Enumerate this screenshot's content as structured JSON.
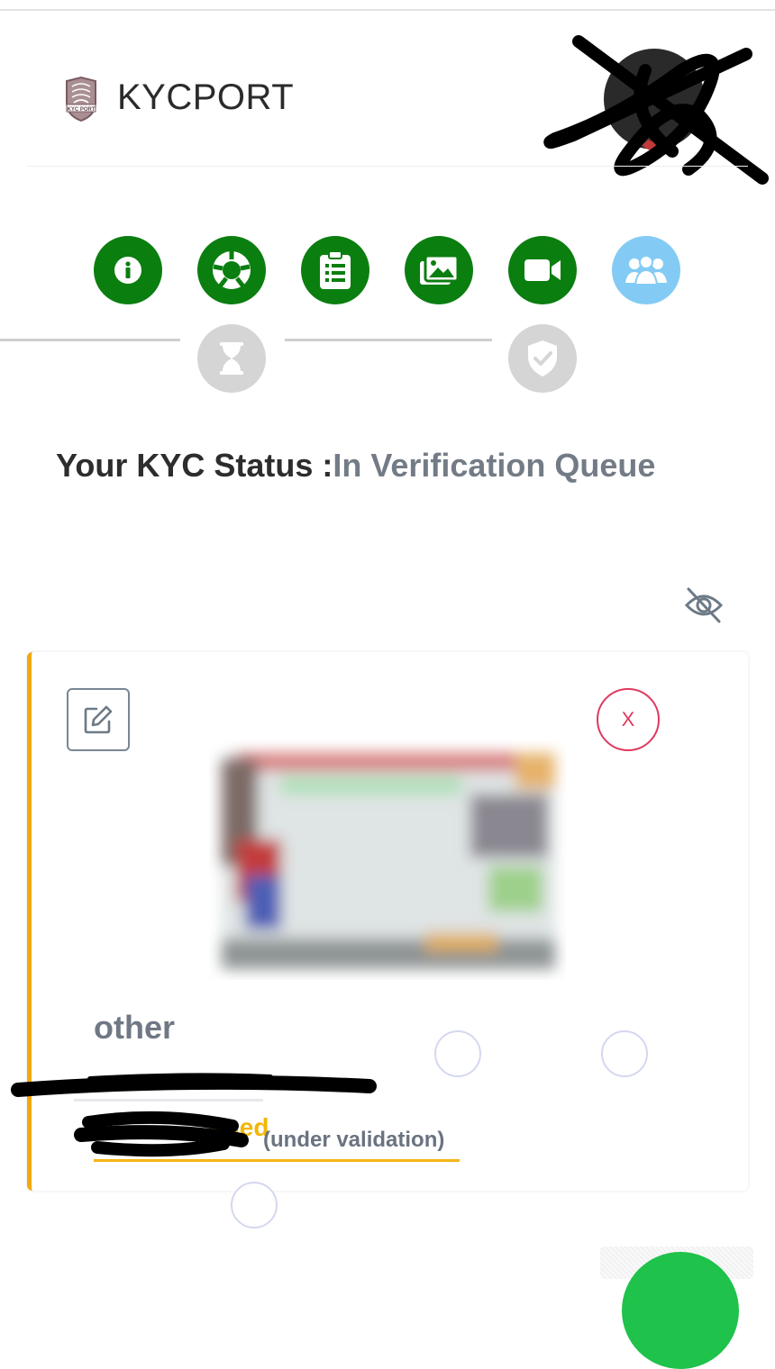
{
  "header": {
    "brand": "KYCPORT",
    "logo_text": "KYC PORT"
  },
  "steps": {
    "top": [
      {
        "name": "info-icon",
        "state": "done"
      },
      {
        "name": "lifebuoy-icon",
        "state": "done"
      },
      {
        "name": "clipboard-icon",
        "state": "done"
      },
      {
        "name": "images-icon",
        "state": "done"
      },
      {
        "name": "video-camera-icon",
        "state": "done"
      },
      {
        "name": "users-icon",
        "state": "active"
      }
    ],
    "bottom": [
      {
        "name": "hourglass-icon",
        "state": "pending"
      },
      {
        "name": "shield-check-icon",
        "state": "pending"
      }
    ],
    "colors": {
      "done": "#0b7e10",
      "active": "#83cbf5",
      "pending": "#d5d5d5"
    }
  },
  "status": {
    "label": "Your KYC Status :",
    "value": "In Verification Queue"
  },
  "document": {
    "type": "other",
    "confirmed_label": "rmed",
    "validation_note": "(under validation)",
    "close_label": "X"
  },
  "colors": {
    "accent": "#f2a90f",
    "danger": "#e0395d",
    "success": "#1fc24a"
  }
}
